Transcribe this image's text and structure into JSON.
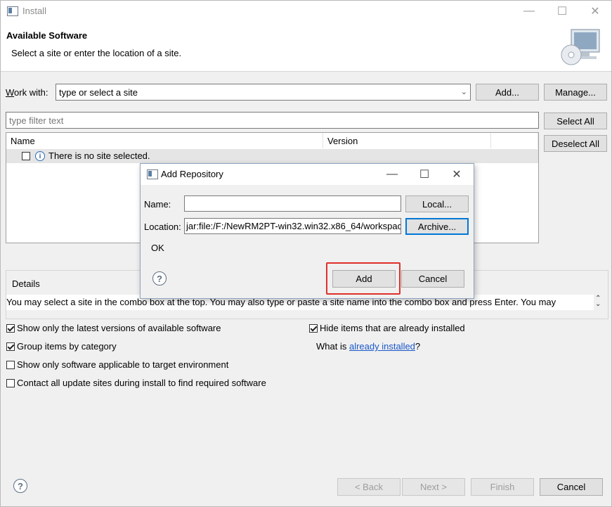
{
  "window": {
    "title": "Install"
  },
  "header": {
    "title": "Available Software",
    "subtitle": "Select a site or enter the location of a site."
  },
  "work_with": {
    "label": "Work with:",
    "value": "type or select a site",
    "add_label": "Add...",
    "manage_label": "Manage..."
  },
  "filter": {
    "placeholder": "type filter text"
  },
  "list_buttons": {
    "select_all": "Select All",
    "deselect_all": "Deselect All"
  },
  "table": {
    "columns": [
      "Name",
      "Version"
    ],
    "rows": [
      {
        "name": "There is no site selected."
      }
    ]
  },
  "dialog": {
    "title": "Add Repository",
    "name_label": "Name:",
    "name_value": "",
    "location_label": "Location:",
    "location_value": "jar:file:/F:/NewRM2PT-win32.win32.x86_64/workspac",
    "local_label": "Local...",
    "archive_label": "Archive...",
    "status": "OK",
    "add_label": "Add",
    "cancel_label": "Cancel"
  },
  "details": {
    "label": "Details",
    "text": "You may select a site in the combo box at the top.  You may also type or paste a site name into the combo box and press Enter.  You may"
  },
  "options": {
    "latest_versions": {
      "label": "Show only the latest versions of available software",
      "checked": true
    },
    "group_by_category": {
      "label": "Group items by category",
      "checked": true
    },
    "applicable_only": {
      "label": "Show only software applicable to target environment",
      "checked": false
    },
    "contact_all": {
      "label": "Contact all update sites during install to find required software",
      "checked": false
    },
    "hide_installed": {
      "label": "Hide items that are already installed",
      "checked": true
    },
    "what_is_prefix": "What is ",
    "already_installed_link": "already installed",
    "what_is_suffix": "?"
  },
  "footer": {
    "back": "< Back",
    "next": "Next >",
    "finish": "Finish",
    "cancel": "Cancel"
  },
  "colors": {
    "highlight": "#e0302a",
    "link": "#1a57c9",
    "selection": "#e5e5e5"
  }
}
